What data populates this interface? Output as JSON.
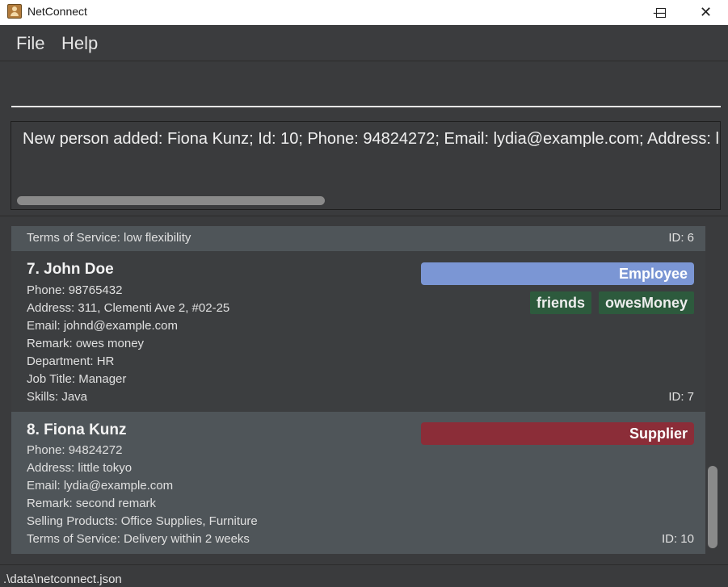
{
  "window": {
    "title": "NetConnect"
  },
  "menu": {
    "file": "File",
    "help": "Help"
  },
  "command": {
    "value": "",
    "placeholder": ""
  },
  "result": {
    "text": "New person added: Fiona Kunz; Id: 10; Phone: 94824272; Email: lydia@example.com; Address: l"
  },
  "cards": {
    "partial": {
      "field_last": "Terms of Service: low flexibility",
      "id": "ID: 6"
    },
    "john": {
      "name": "7.  John Doe",
      "role": "Employee",
      "role_color": "#7b96d4",
      "tags": [
        "friends",
        "owesMoney"
      ],
      "fields": [
        "Phone: 98765432",
        "Address: 311, Clementi Ave 2, #02-25",
        "Email: johnd@example.com",
        "Remark: owes money",
        "Department: HR",
        "Job Title: Manager",
        "Skills: Java"
      ],
      "id": "ID: 7"
    },
    "fiona": {
      "name": "8.  Fiona Kunz",
      "role": "Supplier",
      "role_color": "#8b2d38",
      "fields": [
        "Phone: 94824272",
        "Address: little tokyo",
        "Email: lydia@example.com",
        "Remark: second remark",
        "Selling Products: Office Supplies, Furniture",
        "Terms of Service: Delivery within 2 weeks"
      ],
      "id": "ID: 10"
    }
  },
  "status": {
    "path": ".\\data\\netconnect.json"
  }
}
